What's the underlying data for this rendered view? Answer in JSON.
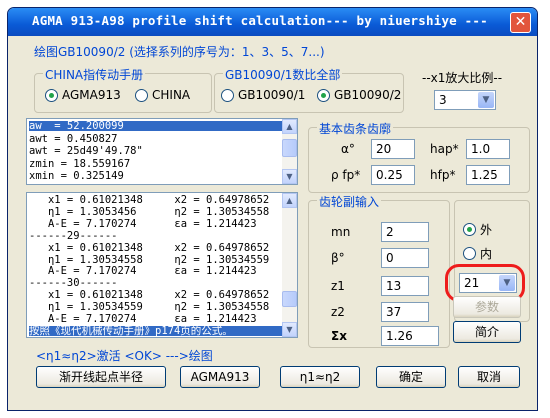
{
  "window": {
    "title": "AGMA 913-A98 profile shift calculation--- by niuershiye ---",
    "close_glyph": "✕"
  },
  "header_label": "绘图GB10090/2 (选择系列的序号为：1、3、5、7...)",
  "china_group": {
    "label": "CHINA指传动手册",
    "opt1": "AGMA913",
    "opt2": "CHINA",
    "selected": "AGMA913"
  },
  "gb_group": {
    "label": "GB10090/1数比全部",
    "opt1": "GB10090/1",
    "opt2": "GB10090/2",
    "selected": "GB10090/2"
  },
  "scale": {
    "label": "--x1放大比例--",
    "value": "3"
  },
  "top_list": [
    "aw  = 52.200099",
    "awt = 0.450827",
    "awt = 25d49'49.78\"",
    "zmin = 18.559167",
    "xmin = 0.325149"
  ],
  "bottom_list": [
    "   x1 = 0.61021348     x2 = 0.64978652",
    "   η1 = 1.3053456      η2 = 1.30534558",
    "   A-E = 7.170274      εa = 1.214423",
    "------29------",
    "   x1 = 0.61021348     x2 = 0.64978652",
    "   η1 = 1.30534558     η2 = 1.30534559",
    "   A-E = 7.170274      εa = 1.214423",
    "------30------",
    "   x1 = 0.61021348     x2 = 0.64978652",
    "   η1 = 1.30534559     η2 = 1.30534558",
    "   A-E = 7.170274      εa = 1.214423",
    "按照《现代机械传动手册》p174页的公式。"
  ],
  "basic_rack": {
    "label": "基本齿条齿廓",
    "alpha_label": "α°",
    "alpha": "20",
    "hap_label": "hap*",
    "hap": "1.0",
    "rho_label": "ρ fp*",
    "rho": "0.25",
    "hfp_label": "hfp*",
    "hfp": "1.25"
  },
  "gear_input": {
    "label": "齿轮副输入",
    "mn_label": "mn",
    "mn": "2",
    "beta_label": "β°",
    "beta": "0",
    "z1_label": "z1",
    "z1": "13",
    "z2_label": "z2",
    "z2": "37",
    "sigma_label": "Σx",
    "sigma": "1.26"
  },
  "side": {
    "ext": "外",
    "int": "内",
    "selected": "外",
    "combo_value": "21",
    "params_btn": "参数",
    "intro_btn": "简介"
  },
  "status_text": "<η1≈η2>激活 <OK> --->绘图",
  "buttons": {
    "start_radius": "渐开线起点半径",
    "agma": "AGMA913",
    "eta": "η1≈η2",
    "ok": "确定",
    "cancel": "取消"
  },
  "colors": {
    "accent": "#0046d5",
    "highlight": "#ee1c1c",
    "title_bar": "#0a5ad6"
  }
}
